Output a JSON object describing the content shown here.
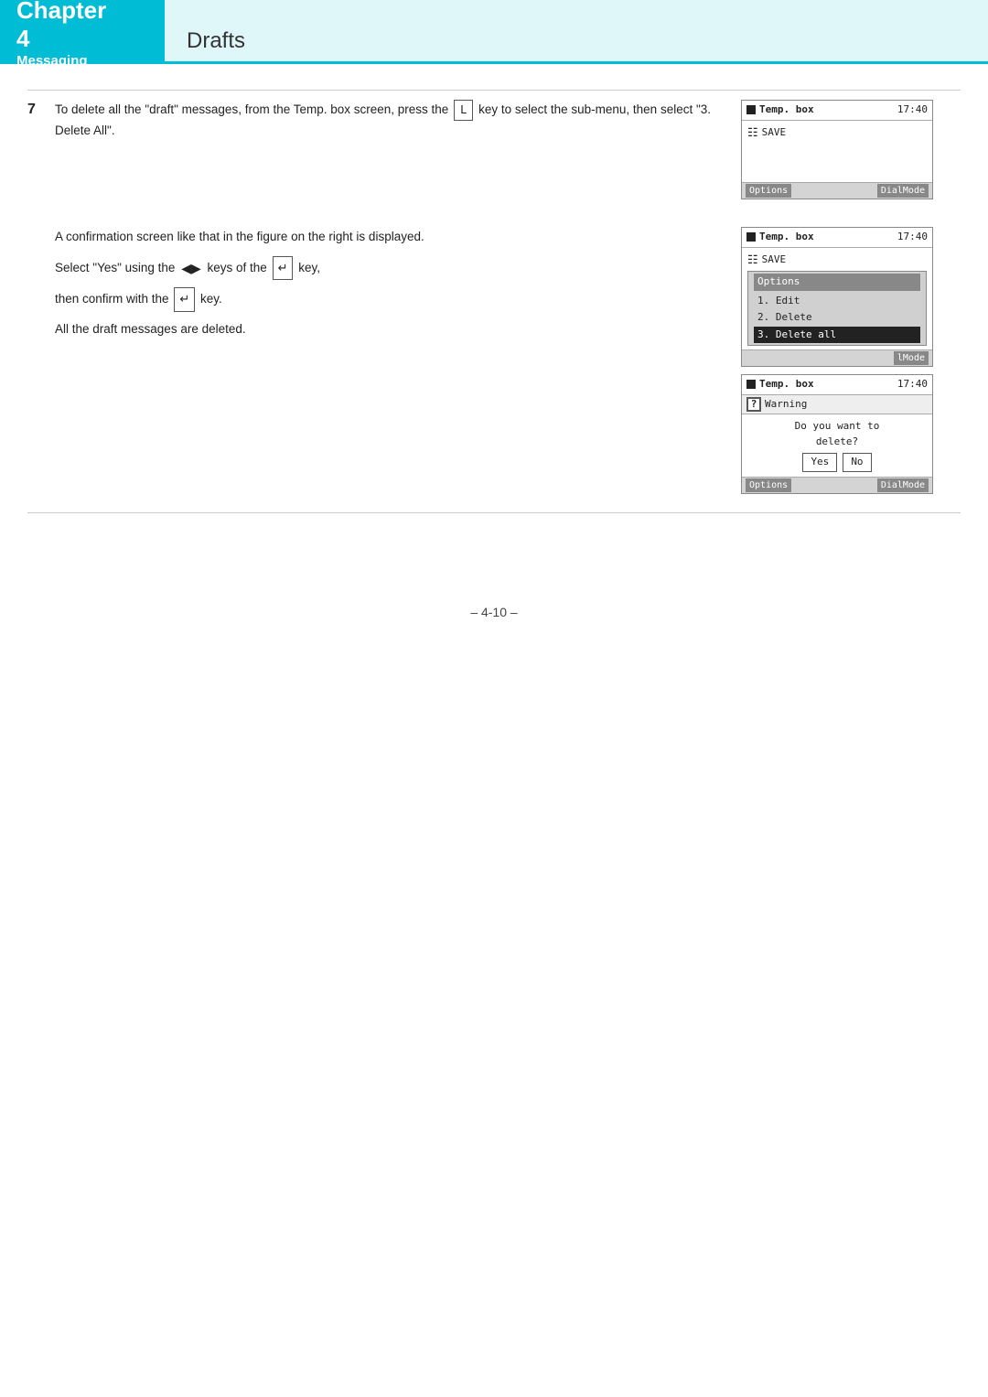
{
  "header": {
    "chapter_label": "Chapter",
    "chapter_number": "4",
    "chapter_subtitle": "Messaging",
    "page_title": "Drafts"
  },
  "step": {
    "number": "7",
    "instruction_1": "To delete all the \"draft\" messages, from the Temp. box screen, press the",
    "key_L": "L",
    "instruction_1b": "key to select the sub-menu, then select \"3. Delete All\".",
    "instruction_2": "A confirmation screen like that in the figure on the right is displayed.",
    "instruction_3a": "Select \"Yes\" using the",
    "arrow_symbol": "◀▶",
    "instruction_3b": "keys of the",
    "instruction_3c": "key,",
    "instruction_4": "then confirm with the",
    "instruction_4b": "key.",
    "instruction_5": "All the draft messages are deleted."
  },
  "screens": {
    "screen1": {
      "title": "Temp. box",
      "time": "17:40",
      "save_label": "SAVE",
      "footer_options": "Options",
      "footer_dialmode": "DialMode"
    },
    "screen2": {
      "title": "Temp. box",
      "time": "17:40",
      "save_label": "SAVE",
      "options_title": "Options",
      "menu_items": [
        "1. Edit",
        "2. Delete",
        "3. Delete all"
      ],
      "footer_dialmode": "lMode"
    },
    "screen3": {
      "title": "Temp. box",
      "time": "17:40",
      "warning_label": "Warning",
      "body_text": "Do you want to",
      "body_text2": "delete?",
      "yes_label": "Yes",
      "no_label": "No",
      "footer_options": "Options",
      "footer_dialmode": "DialMode"
    }
  },
  "footer": {
    "page_number": "– 4-10 –"
  }
}
